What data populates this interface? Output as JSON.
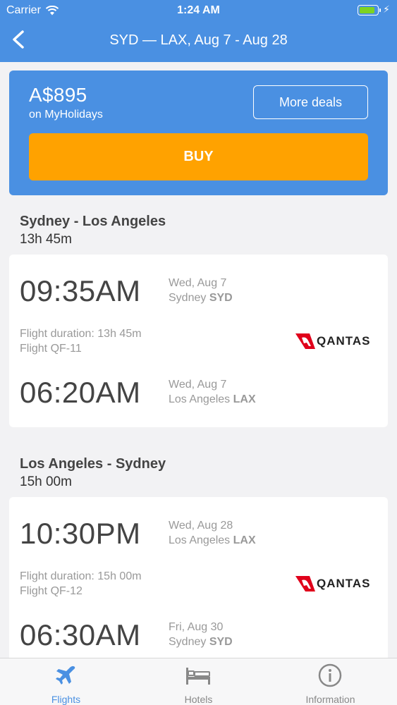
{
  "status": {
    "carrier": "Carrier",
    "time": "1:24 AM"
  },
  "nav": {
    "title": "SYD — LAX, Aug 7 - Aug 28"
  },
  "deal": {
    "price": "A$895",
    "source": "on MyHolidays",
    "more_label": "More deals",
    "buy_label": "BUY"
  },
  "outbound": {
    "title": "Sydney - Los Angeles",
    "duration": "13h 45m",
    "depart_time": "09:35AM",
    "depart_date": "Wed, Aug 7",
    "depart_city": "Sydney",
    "depart_code": "SYD",
    "duration_label": "Flight duration: 13h 45m",
    "flight": "Flight QF-11",
    "airline": "QANTAS",
    "arrive_time": "06:20AM",
    "arrive_date": "Wed, Aug 7",
    "arrive_city": "Los Angeles",
    "arrive_code": "LAX"
  },
  "inbound": {
    "title": "Los Angeles - Sydney",
    "duration": "15h 00m",
    "depart_time": "10:30PM",
    "depart_date": "Wed, Aug 28",
    "depart_city": "Los Angeles",
    "depart_code": "LAX",
    "duration_label": "Flight duration: 15h 00m",
    "flight": "Flight QF-12",
    "airline": "QANTAS",
    "arrive_time": "06:30AM",
    "arrive_date": "Fri, Aug 30",
    "arrive_city": "Sydney",
    "arrive_code": "SYD"
  },
  "tabs": [
    {
      "label": "Flights",
      "icon": "airplane-icon"
    },
    {
      "label": "Hotels",
      "icon": "bed-icon"
    },
    {
      "label": "Information",
      "icon": "info-icon"
    }
  ],
  "colors": {
    "primary": "#4a90e2",
    "buy": "#ffa200",
    "battery": "#7ed321",
    "airline_red": "#e0001b"
  }
}
